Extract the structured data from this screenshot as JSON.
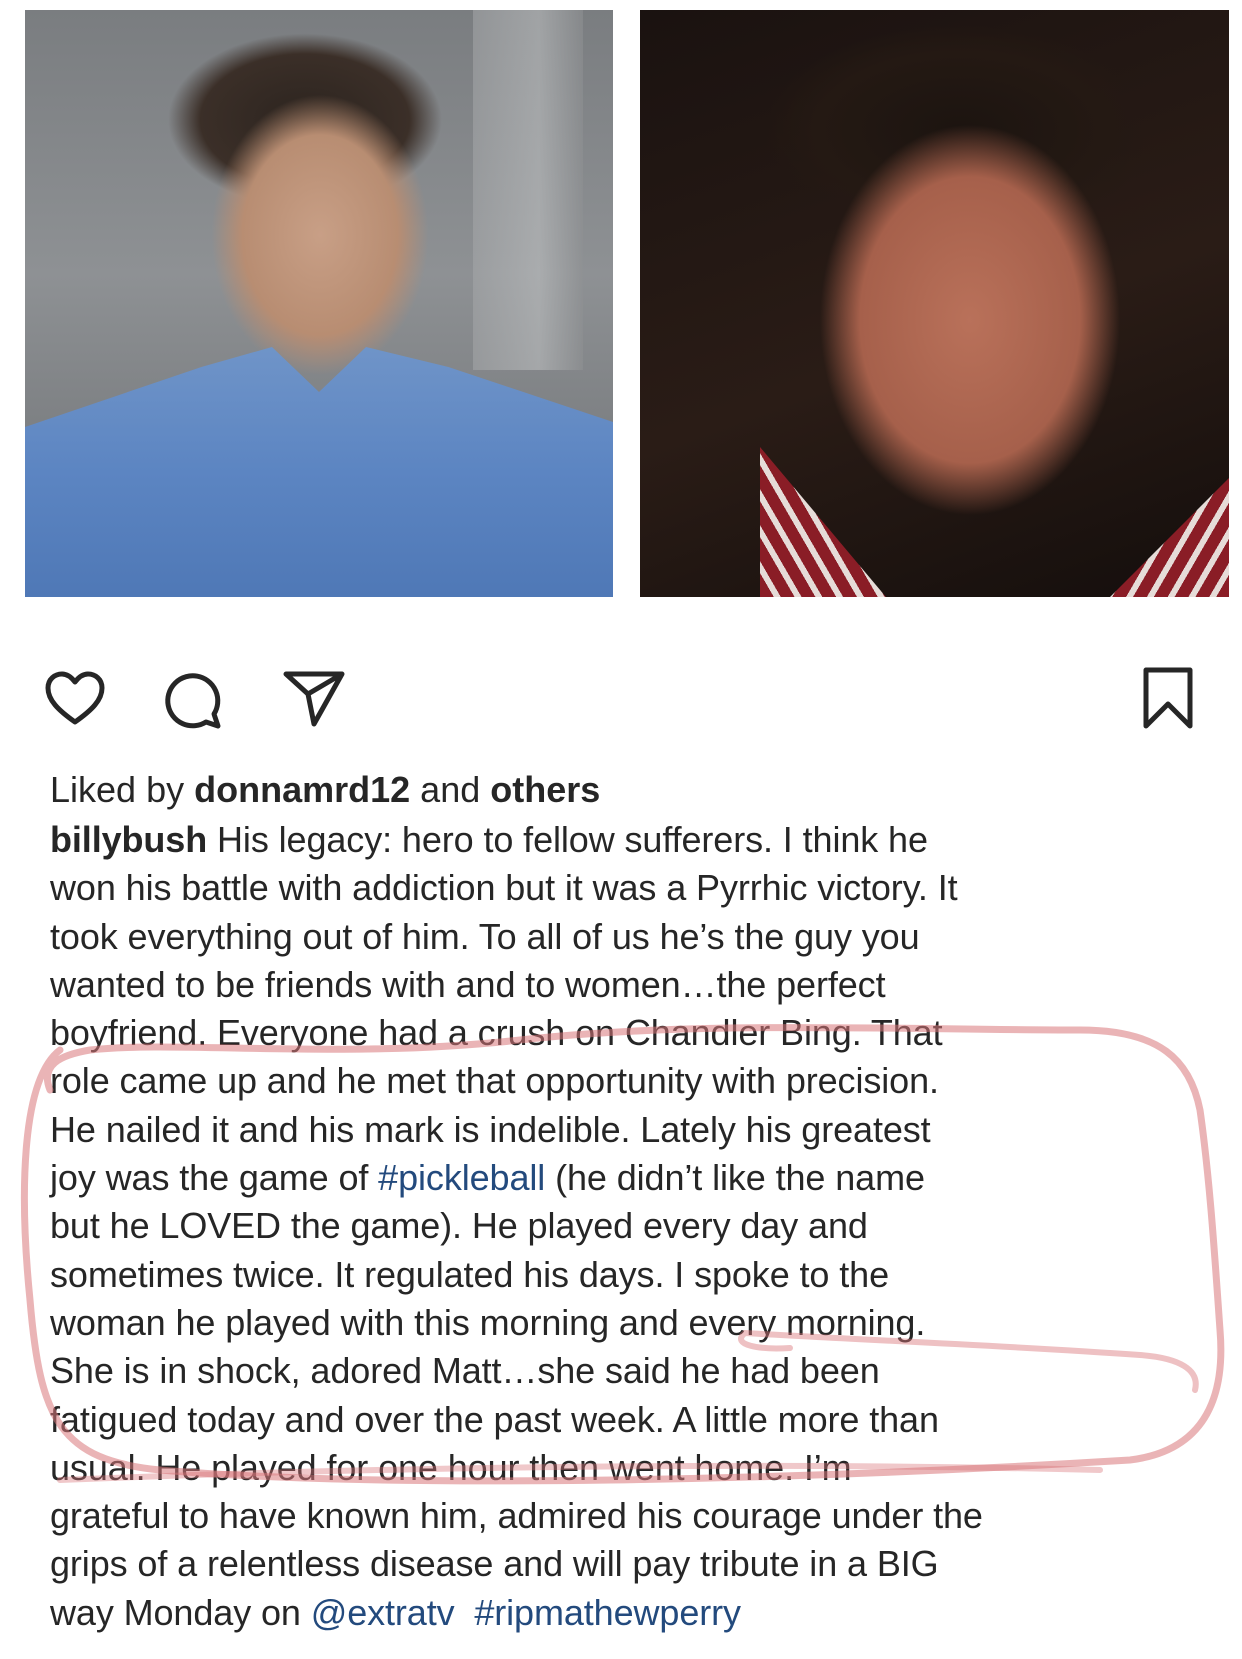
{
  "post": {
    "photos": [
      {
        "name": "photo-left"
      },
      {
        "name": "photo-right"
      }
    ],
    "actions": {
      "like": "heart-icon",
      "comment": "comment-icon",
      "share": "share-icon",
      "save": "bookmark-icon"
    },
    "likes": {
      "prefix": "Liked by",
      "user": "donnamrd12",
      "connector": "and",
      "others": "others"
    },
    "caption": {
      "username": "billybush",
      "lines": [
        " His legacy:  hero to fellow sufferers.  I think he",
        "won his battle with addiction but it was a Pyrrhic victory. It",
        "took everything out of him.  To all of us he’s the guy you",
        "wanted to be friends with and to women…the perfect",
        "boyfriend.  Everyone had a crush on Chandler Bing.  That",
        "role came up and he met that opportunity with precision.",
        "He nailed it and his mark is indelible.  Lately his greatest",
        "joy was the game of ",
        "#pickleball",
        " (he didn’t like the name",
        "but he LOVED the game). He played every day and",
        "sometimes twice.  It regulated his days.  I spoke to the",
        "woman he played with this morning and every morning.",
        "She is in shock, adored Matt…she said he had been",
        "fatigued today and over the past week.  A little more than",
        "usual.  He played for one hour then went home.  I’m",
        "grateful to have known him, admired his courage under the",
        "grips of a relentless disease and will pay tribute in a BIG",
        "way Monday on ",
        "@extratv",
        "#ripmathewperry"
      ]
    },
    "colors": {
      "text": "#262626",
      "link": "#234a7d",
      "annotation": "#d9767a"
    }
  }
}
